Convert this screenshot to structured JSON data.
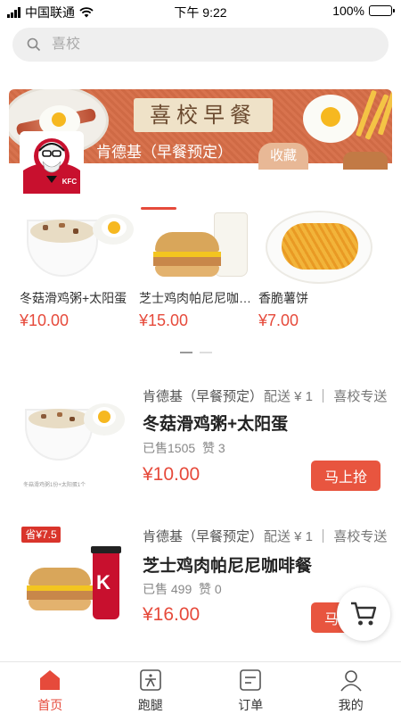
{
  "status_bar": {
    "carrier": "中国联通",
    "time": "下午 9:22",
    "battery": "100%",
    "battery_level": 1.0
  },
  "search": {
    "placeholder": "喜校",
    "icon": "search-icon"
  },
  "banner": {
    "title": "喜校早餐",
    "shop_name": "肯德基（早餐预定）",
    "favorite_label": "收藏",
    "logo_text": "KFC"
  },
  "featured": [
    {
      "name": "冬菇滑鸡粥+太阳蛋",
      "price": "¥10.00"
    },
    {
      "name": "芝士鸡肉帕尼尼咖啡餐",
      "price": "¥15.00"
    },
    {
      "name": "香脆薯饼",
      "price": "¥7.00"
    }
  ],
  "items": [
    {
      "shop": "肯德基（早餐预定）",
      "meta": "配送 ¥ 1 ｜ 喜校专送",
      "title": "冬菇滑鸡粥+太阳蛋",
      "sold": "已售1505",
      "likes": "赞 3",
      "price": "¥10.00",
      "button": "马上抢",
      "thumb_caption": "冬菇滑鸡粥1份+太阳蛋1个"
    },
    {
      "shop": "肯德基（早餐预定）",
      "meta": "配送 ¥ 1 ｜ 喜校专送",
      "title": "芝士鸡肉帕尼尼咖啡餐",
      "sold": "已售 499",
      "likes": "赞 0",
      "price": "¥16.00",
      "button": "马上抢",
      "save_tag": "省¥7.5"
    }
  ],
  "cart": {
    "icon": "cart-icon"
  },
  "tabbar": [
    {
      "label": "首页",
      "icon": "home-icon",
      "active": true
    },
    {
      "label": "跑腿",
      "icon": "errand-icon",
      "active": false
    },
    {
      "label": "订单",
      "icon": "order-icon",
      "active": false
    },
    {
      "label": "我的",
      "icon": "profile-icon",
      "active": false
    }
  ],
  "colors": {
    "accent": "#e64a3b",
    "button": "#e8553f",
    "banner": "#d8734e"
  }
}
